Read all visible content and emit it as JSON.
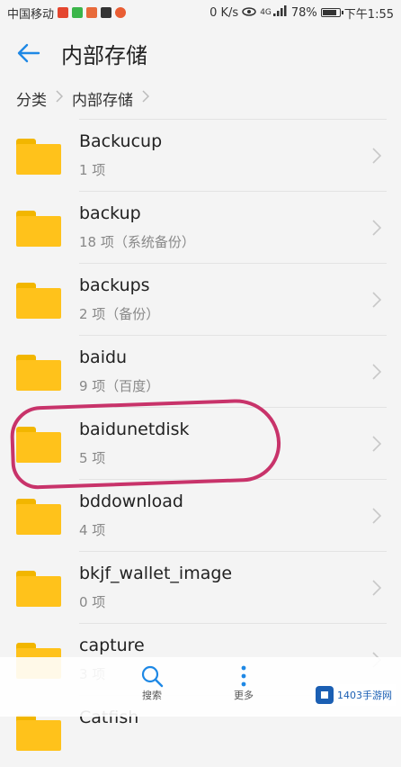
{
  "status_bar": {
    "carrier": "中国移动",
    "network_speed": "0 K/s",
    "signal_label": "4G",
    "battery": "78%",
    "time": "下午1:55"
  },
  "header": {
    "title": "内部存储"
  },
  "breadcrumb": {
    "items": [
      "分类",
      "内部存储"
    ]
  },
  "folders": [
    {
      "name": "Backucup",
      "meta": "1 项"
    },
    {
      "name": "backup",
      "meta": "18 项（系统备份）"
    },
    {
      "name": "backups",
      "meta": "2 项（备份）"
    },
    {
      "name": "baidu",
      "meta": "9 项（百度）"
    },
    {
      "name": "baidunetdisk",
      "meta": "5 项"
    },
    {
      "name": "bddownload",
      "meta": "4 项"
    },
    {
      "name": "bkjf_wallet_image",
      "meta": "0 项"
    },
    {
      "name": "capture",
      "meta": "3 项"
    },
    {
      "name": "Catfish",
      "meta": ""
    }
  ],
  "bottom_bar": {
    "search_label": "搜索",
    "more_label": "更多"
  },
  "watermark": {
    "text": "1403手游网"
  },
  "colors": {
    "accent": "#1e88e5",
    "folder": "#ffc21b",
    "annotation": "#c8336a"
  },
  "icons": [
    "back-arrow-icon",
    "folder-icon",
    "chevron-right-icon",
    "search-icon",
    "more-vert-icon"
  ]
}
